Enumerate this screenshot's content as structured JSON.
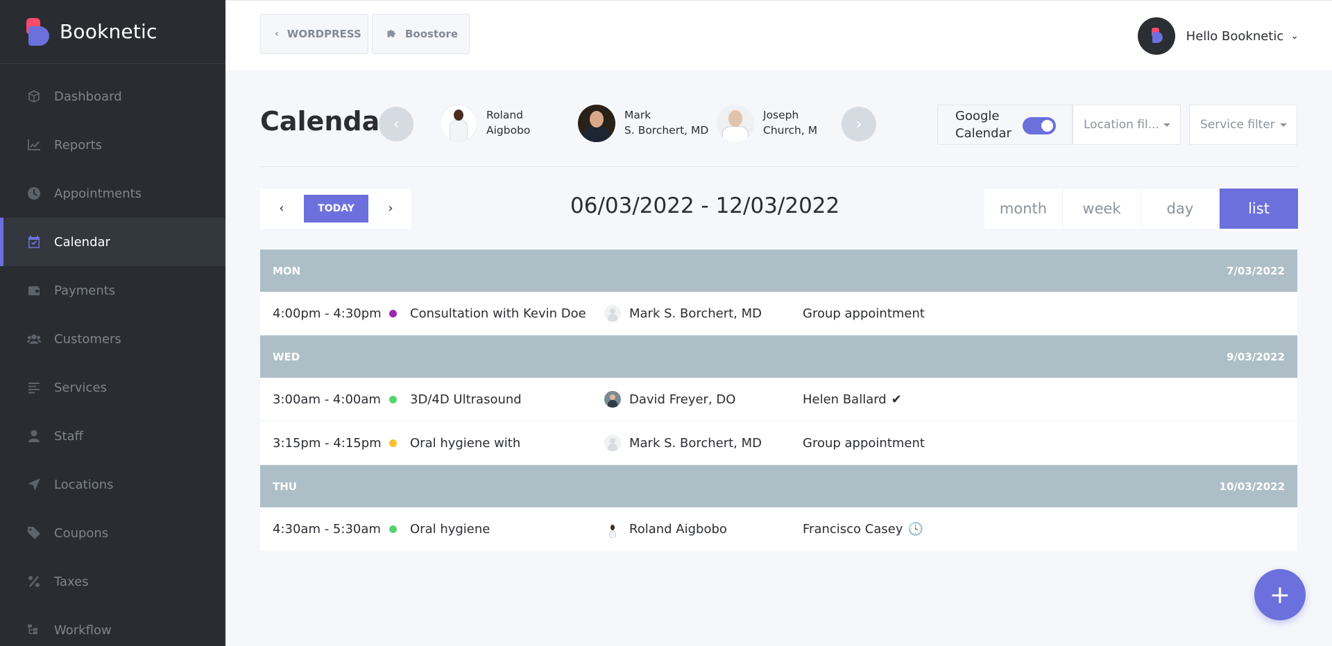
{
  "brand": {
    "name": "Booknetic"
  },
  "sidebar": {
    "items": [
      {
        "label": "Dashboard",
        "icon": "box-icon"
      },
      {
        "label": "Reports",
        "icon": "chart-line-icon"
      },
      {
        "label": "Appointments",
        "icon": "clock-icon"
      },
      {
        "label": "Calendar",
        "icon": "calendar-check-icon",
        "active": true
      },
      {
        "label": "Payments",
        "icon": "wallet-icon"
      },
      {
        "label": "Customers",
        "icon": "users-icon"
      },
      {
        "label": "Services",
        "icon": "list-icon"
      },
      {
        "label": "Staff",
        "icon": "user-icon"
      },
      {
        "label": "Locations",
        "icon": "location-arrow-icon"
      },
      {
        "label": "Coupons",
        "icon": "tag-icon"
      },
      {
        "label": "Taxes",
        "icon": "percent-icon"
      },
      {
        "label": "Workflow",
        "icon": "sitemap-icon"
      }
    ]
  },
  "topbar": {
    "wordpress_label": "WORDPRESS",
    "boostore_label": "Boostore",
    "greeting": "Hello Booknetic"
  },
  "page": {
    "title": "Calendar"
  },
  "staff_carousel": [
    {
      "line1": "Roland",
      "line2": "Aigbobo"
    },
    {
      "line1": "Mark",
      "line2": "S. Borchert, MD"
    },
    {
      "line1": "Joseph",
      "line2": "Church, M"
    }
  ],
  "google_calendar": {
    "line1": "Google",
    "line2": "Calendar",
    "enabled": true
  },
  "filters": {
    "location": "Location fil...",
    "service": "Service filter"
  },
  "toolbar": {
    "today_label": "TODAY",
    "date_range": "06/03/2022 - 12/03/2022",
    "views": [
      "month",
      "week",
      "day",
      "list"
    ],
    "active_view": "list"
  },
  "days": [
    {
      "day": "MON",
      "date": "7/03/2022",
      "events": [
        {
          "time": "4:00pm - 4:30pm",
          "color": "#9c27b0",
          "title": "Consultation with Kevin Doe",
          "staff": "Mark S. Borchert, MD",
          "customer": "Group appointment",
          "status": ""
        }
      ]
    },
    {
      "day": "WED",
      "date": "9/03/2022",
      "events": [
        {
          "time": "3:00am - 4:00am",
          "color": "#53d56c",
          "title": "3D/4D Ultrasound",
          "staff": "David Freyer, DO",
          "customer": "Helen Ballard",
          "status": "✔"
        },
        {
          "time": "3:15pm - 4:15pm",
          "color": "#fbc02d",
          "title": "Oral hygiene with",
          "staff": "Mark S. Borchert, MD",
          "customer": "Group appointment",
          "status": ""
        }
      ]
    },
    {
      "day": "THU",
      "date": "10/03/2022",
      "events": [
        {
          "time": "4:30am - 5:30am",
          "color": "#53d56c",
          "title": "Oral hygiene",
          "staff": "Roland Aigbobo",
          "customer": "Francisco Casey",
          "status": "🕓"
        }
      ]
    }
  ],
  "fab": {
    "label": "+"
  },
  "colors": {
    "accent": "#6c70dc",
    "sidebar_bg": "#292d32",
    "day_header_bg": "#adbec6",
    "brand_red": "#fc4b6c"
  }
}
